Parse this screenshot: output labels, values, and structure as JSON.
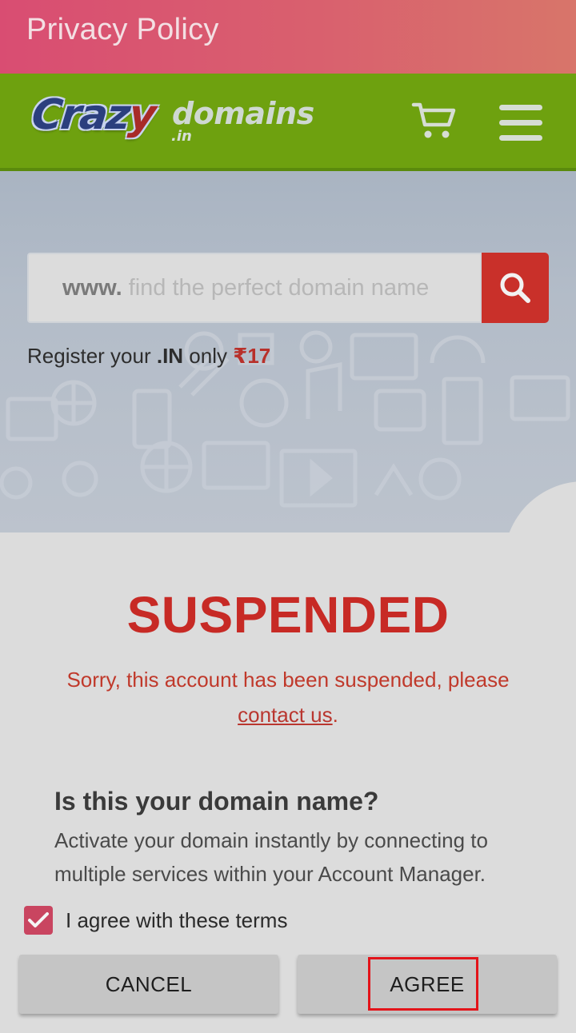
{
  "app_bar": {
    "title": "Privacy Policy"
  },
  "site_header": {
    "logo": {
      "crazy_text": "Craz",
      "crazy_z": "y",
      "domains_text": "domains",
      "tld_text": ".in"
    },
    "cart_icon": "shopping-cart-icon",
    "menu_icon": "hamburger-menu-icon"
  },
  "search": {
    "prefix": "www.",
    "placeholder": "find the perfect domain name",
    "button_icon": "search-icon"
  },
  "promo": {
    "lead": "Register your ",
    "tld": ".IN",
    "middle": " only ",
    "price": "₹17"
  },
  "suspended": {
    "title": "SUSPENDED",
    "message": "Sorry, this account has been suspended, please",
    "link_text": "contact us",
    "link_suffix": "."
  },
  "domain_section": {
    "question": "Is this your domain name?",
    "description": "Activate your domain instantly by connecting to multiple services within your Account Manager."
  },
  "terms": {
    "label": "I agree with these terms",
    "checked": true
  },
  "buttons": {
    "cancel": "CANCEL",
    "agree": "AGREE"
  },
  "colors": {
    "app_bar_start": "#d94d72",
    "header_green": "#6ea10f",
    "accent_red": "#c9302a",
    "checkbox": "#c94560",
    "highlight": "#e3141a"
  }
}
